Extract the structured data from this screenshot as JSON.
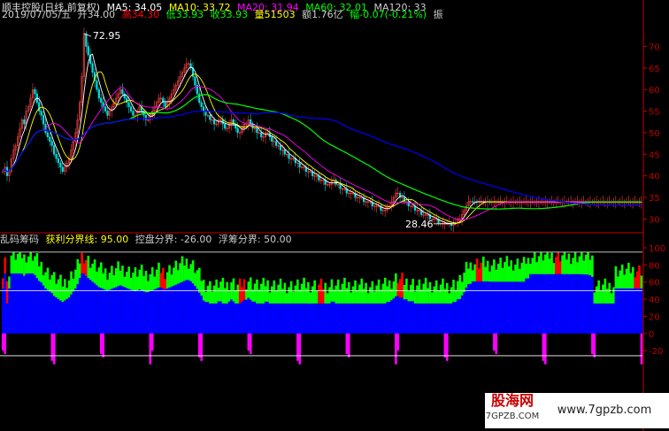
{
  "header": {
    "title": "顺丰控股(日线,前复权)",
    "ma5": "MA5: 34.05",
    "ma10": "MA10: 33.72",
    "ma20": "MA20: 31.94",
    "ma60": "MA60: 32.01",
    "ma120": "MA120: 33",
    "date": "2019/07/05/五",
    "open": "开34.00",
    "high": "高34.30",
    "low": "低33.93",
    "close": "收33.93",
    "volume": "量51503",
    "amount": "额1.76亿",
    "change": "幅-0.07(-0.21%)",
    "cut": "振"
  },
  "sub_header": {
    "name": "乱码筹码",
    "profit_line": "获利分界线: 95.00",
    "control_line": "控盘分界: -26.00",
    "float_line": "浮筹分界: 50.00"
  },
  "annotations": {
    "high_label": "72.95",
    "low_label": "28.46"
  },
  "watermark": {
    "left": "股海网",
    "left_sub": "7GPZB.COM",
    "right": "www.7gpzb.com"
  },
  "colors": {
    "bg": "#000000",
    "ma5": "#ffffff",
    "ma10": "#ffff00",
    "ma20": "#ff00ff",
    "ma60": "#00ff00",
    "ma120": "#0000ff",
    "green_fill": "#00ff00",
    "blue_fill": "#0000ff",
    "red_fill": "#ff0000",
    "magenta_fill": "#ff00ff",
    "axis": "#c00000",
    "hline": "#ffffff"
  },
  "chart_data": [
    {
      "type": "line",
      "title": "顺丰控股(日线,前复权)",
      "yticks": [
        30,
        35,
        40,
        45,
        50,
        55,
        60,
        65,
        70
      ],
      "ylim": [
        27,
        75
      ],
      "n": 300,
      "close": [
        41,
        42,
        40,
        41,
        44,
        46,
        47,
        49,
        51,
        53,
        52,
        55,
        56,
        58,
        60,
        59,
        57,
        55,
        54,
        52,
        50,
        49,
        48,
        47,
        45,
        44,
        43,
        42,
        41,
        42,
        43,
        44,
        46,
        48,
        50,
        53,
        57,
        63,
        72.95,
        70,
        68,
        66,
        64,
        62,
        60,
        58,
        57,
        56,
        55,
        54,
        55,
        56,
        57,
        58,
        59,
        60,
        59,
        58,
        57,
        56,
        55,
        54,
        54,
        55,
        56,
        55,
        54,
        53,
        53,
        54,
        55,
        56,
        57,
        58,
        58,
        57,
        56,
        57,
        58,
        59,
        60,
        61,
        62,
        63,
        64,
        65,
        66,
        66,
        65,
        63,
        61,
        59,
        57,
        56,
        55,
        54,
        54,
        53,
        53,
        52,
        52,
        53,
        53,
        52,
        51,
        51,
        52,
        53,
        52,
        51,
        50,
        50,
        51,
        52,
        52,
        53,
        52,
        51,
        51,
        50,
        50,
        49,
        49,
        50,
        50,
        49,
        48,
        48,
        47,
        47,
        46,
        46,
        45,
        45,
        44,
        44,
        44,
        43,
        43,
        42,
        42,
        42,
        41,
        41,
        41,
        40,
        40,
        40,
        39,
        39,
        39,
        38,
        38,
        38,
        39,
        39,
        38,
        38,
        37,
        37,
        37,
        36,
        36,
        36,
        36,
        35,
        35,
        35,
        35,
        34,
        34,
        34,
        34,
        33,
        33,
        33,
        33,
        32,
        32,
        32,
        33,
        33,
        34,
        35,
        36,
        36,
        35,
        35,
        34,
        34,
        33,
        33,
        33,
        32,
        32,
        32,
        31,
        31,
        31,
        31,
        30,
        30,
        30,
        30,
        29,
        29,
        29,
        29,
        29,
        29,
        28.46,
        29,
        29,
        30,
        30,
        31,
        32,
        33,
        34,
        34.05,
        34,
        34,
        33.93,
        34,
        34,
        34,
        34,
        34,
        33.93,
        33.93,
        33.93,
        33.93,
        33.93,
        33.93,
        33.93,
        33.93,
        33.93,
        33.93,
        33.93,
        33.93,
        33.93,
        33.93,
        33.93,
        33.93,
        33.93,
        33.93,
        33.93,
        33.93,
        33.93,
        33.93,
        33.93,
        33.93,
        33.93,
        33.93,
        33.93,
        33.93,
        33.93,
        33.93,
        33.93,
        33.93,
        33.93,
        33.93,
        33.93,
        33.93,
        33.93,
        33.93,
        33.93,
        33.93,
        33.93,
        33.93,
        33.93,
        33.93,
        33.93,
        33.93,
        33.93,
        33.93,
        33.93,
        33.93,
        33.93,
        33.93,
        33.93,
        33.93,
        33.93,
        33.93,
        33.93,
        33.93,
        33.93,
        33.93,
        33.93,
        33.93,
        33.93,
        33.93,
        33.93,
        33.93,
        33.93,
        33.93,
        33.93,
        33.93,
        33.93,
        33.93,
        33.93,
        33.93,
        33.93,
        33.93,
        33.93,
        33.93,
        33.93,
        33.93,
        33.93,
        33.93,
        33.93,
        33.93
      ]
    },
    {
      "type": "area",
      "title": "乱码筹码",
      "yticks": [
        -20,
        0,
        20,
        40,
        60,
        80,
        100
      ],
      "ylim": [
        -55,
        100
      ],
      "hlines": [
        95,
        50,
        -26
      ],
      "n": 300
    }
  ]
}
